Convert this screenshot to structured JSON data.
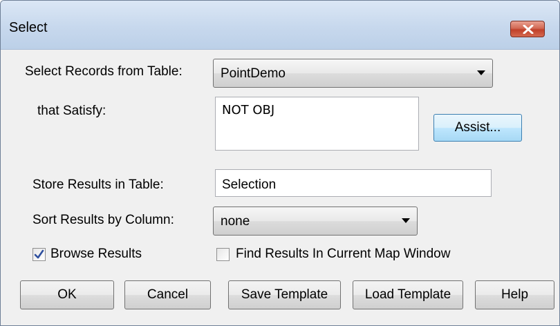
{
  "window": {
    "title": "Select"
  },
  "form": {
    "select_records_label": "Select Records from Table:",
    "table_value": "PointDemo",
    "satisfy_label": "that Satisfy:",
    "expression_value": "NOT OBJ",
    "assist_label": "Assist...",
    "store_results_label": "Store Results in Table:",
    "store_value": "Selection",
    "sort_label": "Sort Results by Column:",
    "sort_value": "none",
    "browse_label": "Browse Results",
    "browse_checked": true,
    "find_label": "Find Results In Current Map Window",
    "find_checked": false
  },
  "buttons": {
    "ok": "OK",
    "cancel": "Cancel",
    "save_template": "Save Template",
    "load_template": "Load Template",
    "help": "Help"
  },
  "icons": {
    "close": "close-icon",
    "dropdown": "chevron-down-icon",
    "checkmark": "checkmark-icon"
  },
  "colors": {
    "close_button": "#c7432c",
    "titlebar": "#c7d8ed",
    "checkmark": "#2e4f9e"
  }
}
